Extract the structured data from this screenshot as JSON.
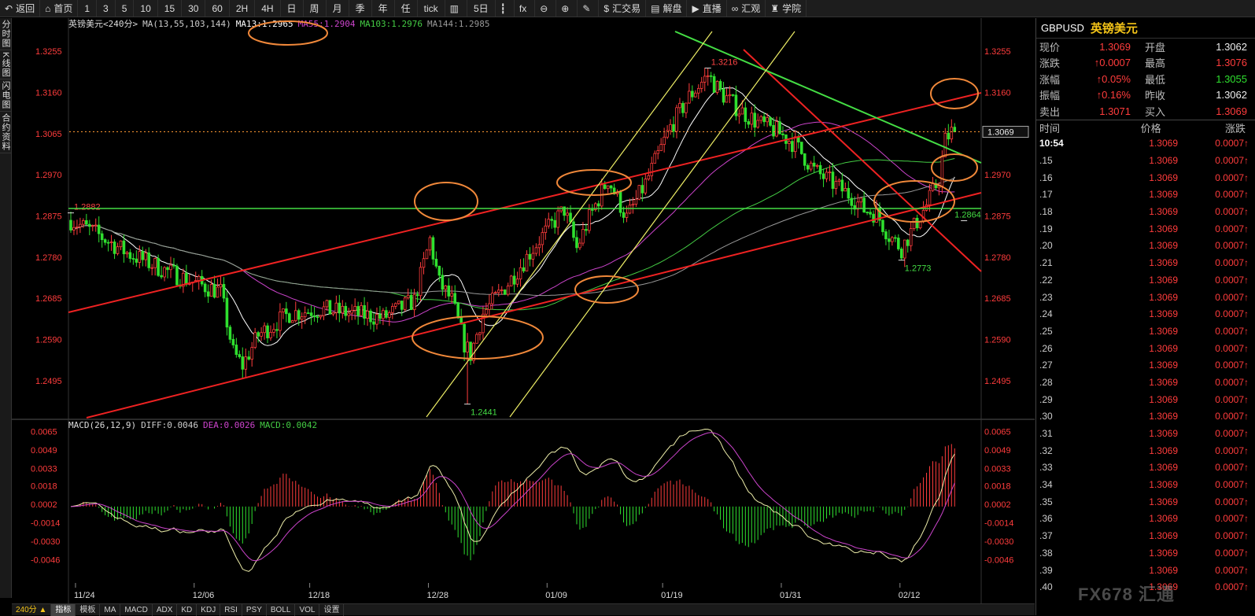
{
  "toolbar": [
    {
      "label": "返回",
      "icon": "back-arrow-icon",
      "glyph": "↶"
    },
    {
      "label": "首页",
      "icon": "home-icon",
      "glyph": "⌂"
    },
    {
      "label": "1"
    },
    {
      "label": "3"
    },
    {
      "label": "5"
    },
    {
      "label": "10"
    },
    {
      "label": "15"
    },
    {
      "label": "30"
    },
    {
      "label": "60"
    },
    {
      "label": "2H"
    },
    {
      "label": "4H"
    },
    {
      "label": "日"
    },
    {
      "label": "周"
    },
    {
      "label": "月"
    },
    {
      "label": "季"
    },
    {
      "label": "年"
    },
    {
      "label": "任"
    },
    {
      "label": "tick"
    },
    {
      "label": "",
      "icon": "bar-chart-icon",
      "glyph": "▥"
    },
    {
      "label": "5日"
    },
    {
      "label": "",
      "icon": "candlestick-icon",
      "glyph": "┇"
    },
    {
      "label": "",
      "icon": "formula-fx-icon",
      "glyph": "fx"
    },
    {
      "label": "",
      "icon": "zoom-out-icon",
      "glyph": "⊖"
    },
    {
      "label": "",
      "icon": "zoom-in-icon",
      "glyph": "⊕"
    },
    {
      "label": "",
      "icon": "draw-pen-icon",
      "glyph": "✎"
    },
    {
      "label": "汇交易",
      "icon": "dollar-icon",
      "glyph": "$"
    },
    {
      "label": "解盘",
      "icon": "chat-icon",
      "glyph": "▤"
    },
    {
      "label": "直播",
      "icon": "live-icon",
      "glyph": "▶"
    },
    {
      "label": "汇观",
      "icon": "link-icon",
      "glyph": "∞"
    },
    {
      "label": "学院",
      "icon": "graduation-cap-icon",
      "glyph": "♜"
    }
  ],
  "leftnav": [
    "分时图",
    "K线图",
    "闪电图",
    "合约资料"
  ],
  "bottombar": {
    "period": "240分 ▲",
    "tabs": [
      "指标",
      "模板",
      "MA",
      "MACD",
      "ADX",
      "KD",
      "KDJ",
      "RSI",
      "PSY",
      "BOLL",
      "VOL",
      "设置"
    ],
    "active": "指标"
  },
  "right": {
    "symbol": "GBPUSD",
    "name": "英镑美元",
    "quotes": [
      {
        "l1": "现价",
        "v1": "1.3069",
        "c1": "red",
        "l2": "开盘",
        "v2": "1.3062",
        "c2": "white"
      },
      {
        "l1": "涨跌",
        "v1": "↑0.0007",
        "c1": "red",
        "l2": "最高",
        "v2": "1.3076",
        "c2": "red"
      },
      {
        "l1": "涨幅",
        "v1": "↑0.05%",
        "c1": "red",
        "l2": "最低",
        "v2": "1.3055",
        "c2": "green"
      },
      {
        "l1": "振幅",
        "v1": "↑0.16%",
        "c1": "red",
        "l2": "昨收",
        "v2": "1.3062",
        "c2": "white"
      },
      {
        "l1": "卖出",
        "v1": "1.3071",
        "c1": "red",
        "l2": "买入",
        "v2": "1.3069",
        "c2": "red"
      }
    ],
    "tick_header": [
      "时间",
      "价格",
      "涨跌"
    ],
    "ticks": [
      {
        "t": "10:54",
        "p": "1.3069",
        "c": "0.0007↑"
      },
      {
        "t": ".15",
        "p": "1.3069",
        "c": "0.0007↑"
      },
      {
        "t": ".16",
        "p": "1.3069",
        "c": "0.0007↑"
      },
      {
        "t": ".17",
        "p": "1.3069",
        "c": "0.0007↑"
      },
      {
        "t": ".18",
        "p": "1.3069",
        "c": "0.0007↑"
      },
      {
        "t": ".19",
        "p": "1.3069",
        "c": "0.0007↑"
      },
      {
        "t": ".20",
        "p": "1.3069",
        "c": "0.0007↑"
      },
      {
        "t": ".21",
        "p": "1.3069",
        "c": "0.0007↑"
      },
      {
        "t": ".22",
        "p": "1.3069",
        "c": "0.0007↑"
      },
      {
        "t": ".23",
        "p": "1.3069",
        "c": "0.0007↑"
      },
      {
        "t": ".24",
        "p": "1.3069",
        "c": "0.0007↑"
      },
      {
        "t": ".25",
        "p": "1.3069",
        "c": "0.0007↑"
      },
      {
        "t": ".26",
        "p": "1.3069",
        "c": "0.0007↑"
      },
      {
        "t": ".27",
        "p": "1.3069",
        "c": "0.0007↑"
      },
      {
        "t": ".28",
        "p": "1.3069",
        "c": "0.0007↑"
      },
      {
        "t": ".29",
        "p": "1.3069",
        "c": "0.0007↑"
      },
      {
        "t": ".30",
        "p": "1.3069",
        "c": "0.0007↑"
      },
      {
        "t": ".31",
        "p": "1.3069",
        "c": "0.0007↑"
      },
      {
        "t": ".32",
        "p": "1.3069",
        "c": "0.0007↑"
      },
      {
        "t": ".33",
        "p": "1.3069",
        "c": "0.0007↑"
      },
      {
        "t": ".34",
        "p": "1.3069",
        "c": "0.0007↑"
      },
      {
        "t": ".35",
        "p": "1.3069",
        "c": "0.0007↑"
      },
      {
        "t": ".36",
        "p": "1.3069",
        "c": "0.0007↑"
      },
      {
        "t": ".37",
        "p": "1.3069",
        "c": "0.0007↑"
      },
      {
        "t": ".38",
        "p": "1.3069",
        "c": "0.0007↑"
      },
      {
        "t": ".39",
        "p": "1.3069",
        "c": "0.0007↑"
      },
      {
        "t": ".40",
        "p": "1.3069",
        "c": "0.0007↑"
      }
    ]
  },
  "watermark": "FX678 汇通",
  "chart_data": [
    {
      "type": "candlestick",
      "title": "英镑美元<240分>",
      "ma_legend": [
        {
          "name": "MA(13,55,103,144)",
          "value": "",
          "color": "#cccccc"
        },
        {
          "name": "MA13",
          "value": "1.2965",
          "color": "#ffffff"
        },
        {
          "name": "MA55",
          "value": "1.2904",
          "color": "#cc44cc"
        },
        {
          "name": "MA103",
          "value": "1.2976",
          "color": "#44cc44"
        },
        {
          "name": "MA144",
          "value": "1.2985",
          "color": "#999999"
        }
      ],
      "ylim": [
        1.2415,
        1.3295
      ],
      "yticks": [
        "1.3255",
        "1.3160",
        "1.3065",
        "1.2970",
        "1.2875",
        "1.2780",
        "1.2685",
        "1.2590",
        "1.2495"
      ],
      "xticks": [
        "11/24",
        "12/06",
        "12/18",
        "12/28",
        "01/09",
        "01/19",
        "01/31",
        "02/12"
      ],
      "current_price_label": "1.3069",
      "current_price": 1.3069,
      "anchors": [
        {
          "i": 0,
          "v": 1.2865
        },
        {
          "i": 8,
          "v": 1.2835
        },
        {
          "i": 18,
          "v": 1.279
        },
        {
          "i": 30,
          "v": 1.275
        },
        {
          "i": 40,
          "v": 1.272
        },
        {
          "i": 48,
          "v": 1.27
        },
        {
          "i": 52,
          "v": 1.256
        },
        {
          "i": 55,
          "v": 1.253
        },
        {
          "i": 60,
          "v": 1.26
        },
        {
          "i": 70,
          "v": 1.265
        },
        {
          "i": 80,
          "v": 1.266
        },
        {
          "i": 90,
          "v": 1.265
        },
        {
          "i": 100,
          "v": 1.264
        },
        {
          "i": 110,
          "v": 1.268
        },
        {
          "i": 115,
          "v": 1.282
        },
        {
          "i": 118,
          "v": 1.272
        },
        {
          "i": 122,
          "v": 1.268
        },
        {
          "i": 126,
          "v": 1.258
        },
        {
          "i": 128,
          "v": 1.2555
        },
        {
          "i": 132,
          "v": 1.265
        },
        {
          "i": 140,
          "v": 1.272
        },
        {
          "i": 150,
          "v": 1.282
        },
        {
          "i": 158,
          "v": 1.289
        },
        {
          "i": 162,
          "v": 1.28
        },
        {
          "i": 166,
          "v": 1.287
        },
        {
          "i": 172,
          "v": 1.296
        },
        {
          "i": 178,
          "v": 1.287
        },
        {
          "i": 184,
          "v": 1.295
        },
        {
          "i": 192,
          "v": 1.308
        },
        {
          "i": 198,
          "v": 1.315
        },
        {
          "i": 204,
          "v": 1.32
        },
        {
          "i": 208,
          "v": 1.316
        },
        {
          "i": 214,
          "v": 1.312
        },
        {
          "i": 220,
          "v": 1.309
        },
        {
          "i": 226,
          "v": 1.307
        },
        {
          "i": 232,
          "v": 1.304
        },
        {
          "i": 238,
          "v": 1.298
        },
        {
          "i": 244,
          "v": 1.295
        },
        {
          "i": 250,
          "v": 1.292
        },
        {
          "i": 254,
          "v": 1.289
        },
        {
          "i": 258,
          "v": 1.288
        },
        {
          "i": 262,
          "v": 1.283
        },
        {
          "i": 266,
          "v": 1.28
        },
        {
          "i": 270,
          "v": 1.285
        },
        {
          "i": 274,
          "v": 1.29
        },
        {
          "i": 278,
          "v": 1.296
        },
        {
          "i": 280,
          "v": 1.305
        },
        {
          "i": 282,
          "v": 1.3069
        }
      ],
      "price_labels": [
        {
          "text": "1.2882",
          "i": 0,
          "v": 1.2882,
          "color": "#ff4444"
        },
        {
          "text": "1.3216",
          "i": 204,
          "v": 1.3216,
          "color": "#ff4444"
        },
        {
          "text": "1.2441",
          "i": 127,
          "v": 1.2441,
          "color": "#44dd44"
        },
        {
          "text": "1.2773",
          "i": 266,
          "v": 1.2773,
          "color": "#44dd44"
        },
        {
          "text": "1.2864",
          "i": 286,
          "v": 1.2864,
          "color": "#44dd44"
        }
      ]
    },
    {
      "type": "bar",
      "title": "MACD(26,12,9)",
      "legend": [
        {
          "name": "DIFF",
          "value": "0.0046",
          "color": "#cccccc"
        },
        {
          "name": "DEA",
          "value": "0.0026",
          "color": "#cc44cc"
        },
        {
          "name": "MACD",
          "value": "0.0042",
          "color": "#44cc44"
        }
      ],
      "ylim": [
        -0.0062,
        0.0072
      ],
      "yticks": [
        "0.0065",
        "0.0049",
        "0.0033",
        "0.0018",
        "0.0002",
        "-0.0014",
        "-0.0030",
        "-0.0046"
      ]
    }
  ]
}
